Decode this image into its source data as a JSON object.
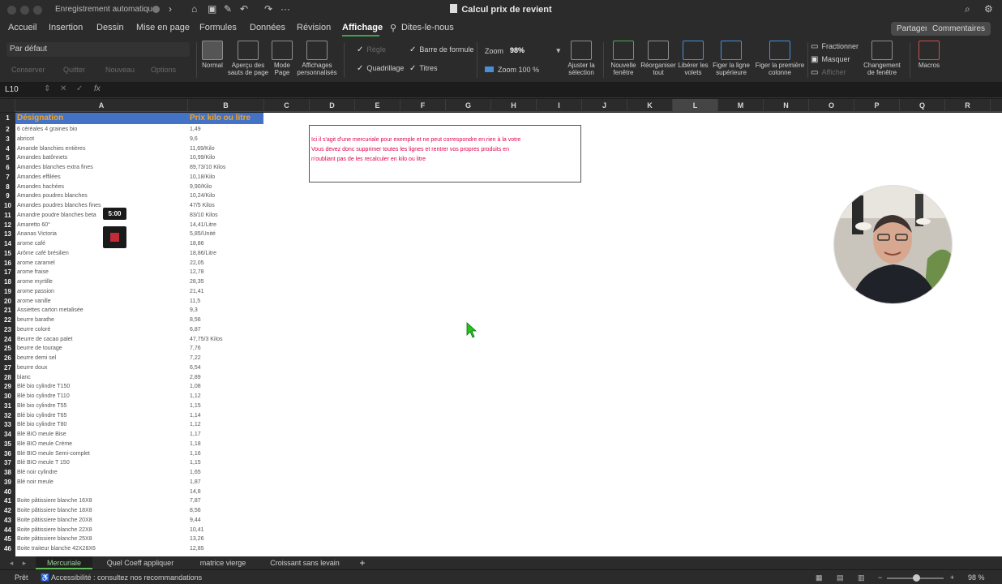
{
  "titlebar": {
    "autosave_label": "Enregistrement automatique",
    "document_title": "Calcul prix de revient"
  },
  "menu": [
    "Accueil",
    "Insertion",
    "Dessin",
    "Mise en page",
    "Formules",
    "Données",
    "Révision",
    "Affichage",
    "Dites-le-nous"
  ],
  "active_menu": "Affichage",
  "share_button": "Partager",
  "comments_button": "Commentaires",
  "ribbon": {
    "view_select": "Par défaut",
    "view_buttons": [
      "Conserver",
      "Quitter",
      "Nouveau",
      "Options"
    ],
    "normal": "Normal",
    "page_break": "Aperçu des sauts de page",
    "page_mode": "Mode Page",
    "custom_views": "Affichages personnalisés",
    "ruler": "Règle",
    "formula_bar": "Barre de formule",
    "gridlines": "Quadrillage",
    "headings": "Titres",
    "zoom_label": "Zoom",
    "zoom_value": "98%",
    "zoom_100": "Zoom 100 %",
    "fit_selection": "Ajuster la sélection",
    "new_window": "Nouvelle fenêtre",
    "arrange_all": "Réorganiser tout",
    "unfreeze": "Libérer les volets",
    "freeze_top": "Figer la ligne supérieure",
    "freeze_first": "Figer la première colonne",
    "split": "Fractionner",
    "hide": "Masquer",
    "unhide": "Afficher",
    "switch_window": "Changement de fenêtre",
    "macros": "Macros"
  },
  "formula_bar": {
    "name_box": "L10",
    "fx": "fx",
    "content": ""
  },
  "columns": [
    "A",
    "B",
    "C",
    "D",
    "E",
    "F",
    "G",
    "H",
    "I",
    "J",
    "K",
    "L",
    "M",
    "N",
    "O",
    "P",
    "Q",
    "R"
  ],
  "selected_column": "L",
  "header": {
    "a": "Désignation",
    "b": "Prix kilo ou litre"
  },
  "rows": [
    {
      "n": "2",
      "a": "6 céréales 4 graines bio",
      "b": "1,49"
    },
    {
      "n": "3",
      "a": "abricot",
      "b": "9,6"
    },
    {
      "n": "4",
      "a": "Amande blanchies entières",
      "b": "11,69/Kilo"
    },
    {
      "n": "5",
      "a": "Amandes batônnets",
      "b": "10,99/Kilo"
    },
    {
      "n": "6",
      "a": "Amandes blanches extra fines",
      "b": "89,73/10 Kilos"
    },
    {
      "n": "7",
      "a": "Amandes effilées",
      "b": "10,18/Kilo"
    },
    {
      "n": "8",
      "a": "Amandes hachées",
      "b": "9,90/Kilo"
    },
    {
      "n": "9",
      "a": "Amandes poudres blanches",
      "b": "10,24/Kilo"
    },
    {
      "n": "10",
      "a": "Amandes poudres blanches fines",
      "b": "47/5 Kilos"
    },
    {
      "n": "11",
      "a": "Amandre poudre blanches beta",
      "b": "83/10 Kilos"
    },
    {
      "n": "12",
      "a": "Amaretto 60°",
      "b": "14,41/Litre"
    },
    {
      "n": "13",
      "a": "Ananas Victoria",
      "b": "5,85/Unité"
    },
    {
      "n": "14",
      "a": "arome café",
      "b": "18,86"
    },
    {
      "n": "15",
      "a": "Arôme café brésilien",
      "b": "18,86/Litre"
    },
    {
      "n": "16",
      "a": "arome caramel",
      "b": "22,05"
    },
    {
      "n": "17",
      "a": "arome fraise",
      "b": "12,78"
    },
    {
      "n": "18",
      "a": "arome myrtille",
      "b": "28,35"
    },
    {
      "n": "19",
      "a": "arome passion",
      "b": "21,41"
    },
    {
      "n": "20",
      "a": "arome vanille",
      "b": "11,5"
    },
    {
      "n": "21",
      "a": "Assiettes carton metalisée",
      "b": "9,3"
    },
    {
      "n": "22",
      "a": "beurre barathe",
      "b": "8,56"
    },
    {
      "n": "23",
      "a": "beurre coloré",
      "b": "6,87"
    },
    {
      "n": "24",
      "a": "Beurre de cacao palet",
      "b": "47,75/3 Kilos"
    },
    {
      "n": "25",
      "a": "beurre de tourage",
      "b": "7,76"
    },
    {
      "n": "26",
      "a": "beurre demi sel",
      "b": "7,22"
    },
    {
      "n": "27",
      "a": "beurre doux",
      "b": "6,54"
    },
    {
      "n": "28",
      "a": "blanc",
      "b": "2,89"
    },
    {
      "n": "29",
      "a": "Blé bio cylindre T150",
      "b": "1,08"
    },
    {
      "n": "30",
      "a": "Blé bio cylindre T110",
      "b": "1,12"
    },
    {
      "n": "31",
      "a": "Blé bio cylindre T55",
      "b": "1,15"
    },
    {
      "n": "32",
      "a": "Blé bio cylindre T65",
      "b": "1,14"
    },
    {
      "n": "33",
      "a": "Blé bio cylindre T80",
      "b": "1,12"
    },
    {
      "n": "34",
      "a": "Blé BIO meule Bise",
      "b": "1,17"
    },
    {
      "n": "35",
      "a": "Blé BIO meule Crème",
      "b": "1,18"
    },
    {
      "n": "36",
      "a": "Blé BIO meule Semi-complet",
      "b": "1,16"
    },
    {
      "n": "37",
      "a": "Blé BIO meule T 150",
      "b": "1,15"
    },
    {
      "n": "38",
      "a": "Blé noir cylindre",
      "b": "1,65"
    },
    {
      "n": "39",
      "a": "Blé noir meule",
      "b": "1,87"
    },
    {
      "n": "40",
      "a": "",
      "b": "14,8"
    },
    {
      "n": "41",
      "a": "Boite pâtissiere blanche 16X8",
      "b": "7,87"
    },
    {
      "n": "42",
      "a": "Boite pâtissiere blanche 18X8",
      "b": "8,56"
    },
    {
      "n": "43",
      "a": "Boite pâtissiere blanche 20X8",
      "b": "9,44"
    },
    {
      "n": "44",
      "a": "Boite pâtissiere blanche 22X8",
      "b": "10,41"
    },
    {
      "n": "45",
      "a": "Boite pâtissiere blanche 25X8",
      "b": "13,26"
    },
    {
      "n": "46",
      "a": "Boite traiteur blanche 42X28X6",
      "b": "12,85"
    }
  ],
  "note_lines": [
    "Ici il s'agit d'une mercuriale pour exemple et ne peut correspondre en rien à la votre",
    "Vous devez donc supprimer toutes les lignes et rentrer vos propres produits en",
    "n'oubliant pas de les recalculer en kilo ou litre"
  ],
  "timer": "5:00",
  "sheet_tabs": [
    "Mercuriale",
    "Quel Coeff appliquer",
    "matrice vierge",
    "Croissant sans levain"
  ],
  "active_tab": "Mercuriale",
  "status": {
    "ready": "Prêt",
    "accessibility": "Accessibilité : consultez nos recommandations",
    "zoom": "98 %"
  },
  "colors": {
    "header_fill": "#4472c4",
    "header_text": "#f6a21c",
    "note_text": "#e0004d",
    "accent": "#3fa34d"
  }
}
